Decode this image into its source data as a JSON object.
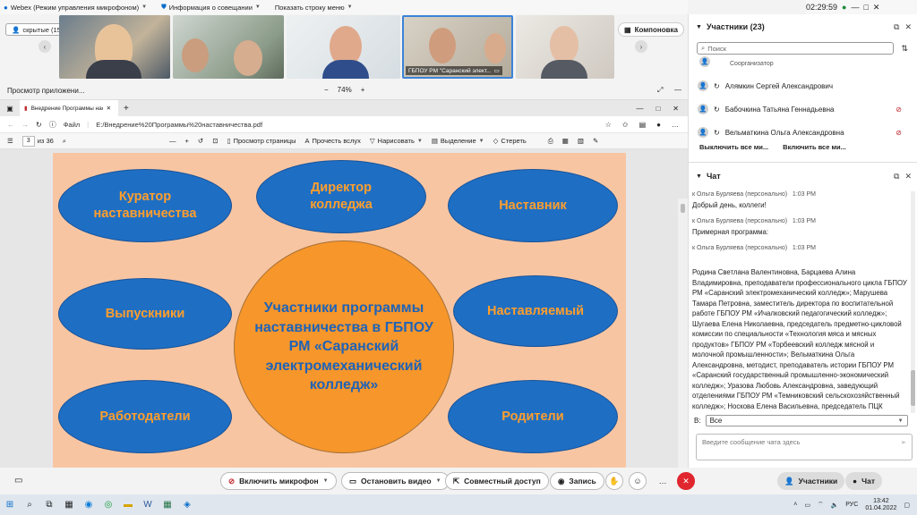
{
  "top_bar": {
    "app_title": "Webex (Режим управления микрофоном)",
    "meeting_info": "Информация о совещании",
    "show_menu": "Показать строку меню",
    "timer": "02:29:59"
  },
  "video_strip": {
    "hidden_label": "скрытые (15)",
    "tile_label": "ГБПОУ РМ \"Саранский элект...",
    "layout_label": "Компоновка"
  },
  "share": {
    "preview_label": "Просмотр приложени...",
    "zoom_level": "74%",
    "minus": "−",
    "plus": "+"
  },
  "browser": {
    "tab_title": "Внедрение Программы настав",
    "address_prefix": "Файл",
    "address": "E:/Внедрение%20Программы%20наставничества.pdf"
  },
  "pdf_toolbar": {
    "page": "3",
    "page_total": "из 36",
    "page_view": "Просмотр страницы",
    "read_aloud": "Прочесть вслух",
    "draw": "Нарисовать",
    "highlight": "Выделение",
    "erase": "Стереть"
  },
  "slide": {
    "center": "Участники программы наставничества в ГБПОУ РМ «Саранский электромеханический колледж»",
    "curator": "Куратор наставничества",
    "director": "Директор колледжа",
    "mentor": "Наставник",
    "graduates": "Выпускники",
    "mentee": "Наставляемый",
    "employers": "Работодатели",
    "parents": "Родители"
  },
  "participants": {
    "title": "Участники (23)",
    "search_placeholder": "Поиск",
    "cohost_label": "Соорганизатор",
    "items": [
      {
        "name": "Алямкин Сергей Александрович"
      },
      {
        "name": "Бабочкина Татьяна Геннадьевна"
      },
      {
        "name": "Вельматкина Ольга Александровна"
      }
    ],
    "mute_all": "Выключить все ми...",
    "unmute_all": "Включить все ми..."
  },
  "chat": {
    "title": "Чат",
    "messages": [
      {
        "meta": "к Ольга Бурляева (персонально)",
        "time": "1:03 PM",
        "text": "Добрый день, коллеги!"
      },
      {
        "meta": "к Ольга Бурляева (персонально)",
        "time": "1:03 PM",
        "text": "Примерная программа:"
      },
      {
        "meta": "к Ольга Бурляева (персонально)",
        "time": "1:03 PM",
        "text": "Родина Светлана Валентиновна, Барцаева Алина Владимировна, преподаватели профессионального цикла ГБПОУ РМ «Саранский электромеханический колледж»; Марушева Тамара Петровна, заместитель директора по воспитательной работе ГБПОУ РМ «Ичалковский педагогический колледж»; Шугаева Елена Николаевна, председатель предметно-цикловой комиссии по специальности «Технология мяса и мясных продуктов» ГБПОУ РМ «Торбеевский колледж мясной и молочной промышленности»; Вельматкина Ольга Александровна, методист, преподаватель истории ГБПОУ РМ «Саранский государственный промышленно-экономический колледж»; Уразова Любовь Александровна, заведующий отделениями ГБПОУ РМ «Темниковский сельскохозяйственный колледж»; Носкова Елена Васильевна, председатель ПЦК ГБПОУ РМ"
      }
    ],
    "to_label": "В:",
    "to_value": "Все",
    "input_placeholder": "Введите сообщение чата здесь"
  },
  "controls": {
    "mic": "Включить микрофон",
    "video": "Остановить видео",
    "share": "Совместный доступ",
    "record": "Запись",
    "participants": "Участники",
    "chat": "Чат"
  },
  "taskbar": {
    "lang": "РУС",
    "time": "13:42",
    "date": "01.04.2022"
  },
  "colors": {
    "slide_bg": "#f8c5a2",
    "ellipse": "#1e6fc4",
    "ellipse_text": "#ff9e2c",
    "center": "#f7962a",
    "center_text": "#1e63b8",
    "end_call": "#e0262e"
  }
}
